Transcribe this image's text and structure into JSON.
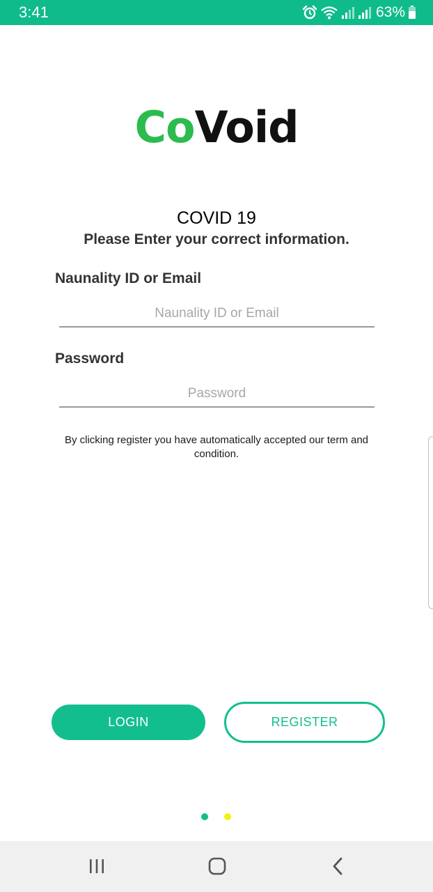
{
  "status_bar": {
    "time": "3:41",
    "battery": "63%",
    "icons": [
      "alarm-icon",
      "wifi-icon",
      "signal-icon",
      "signal-icon",
      "battery-icon"
    ],
    "color": "#0fbb8b"
  },
  "logo": {
    "part1": "Co",
    "part2": "Void",
    "part1_color": "#2bbc4d",
    "part2_color": "#111111"
  },
  "header": {
    "title": "COVID 19",
    "subtitle": "Please Enter your correct information."
  },
  "form": {
    "id_label": "Naunality ID or Email",
    "id_placeholder": "Naunality ID or Email",
    "id_value": "",
    "password_label": "Password",
    "password_placeholder": "Password",
    "password_value": "",
    "terms": "By clicking register you have automatically accepted our term and condition."
  },
  "actions": {
    "login_label": "LOGIN",
    "register_label": "REGISTER",
    "accent_color": "#13be8e"
  },
  "pager": {
    "dots": 2,
    "active_index": 0,
    "colors": [
      "#13be8e",
      "#f2f20f"
    ]
  },
  "nav_bar": {
    "icons": [
      "recents-icon",
      "home-icon",
      "back-icon"
    ]
  }
}
